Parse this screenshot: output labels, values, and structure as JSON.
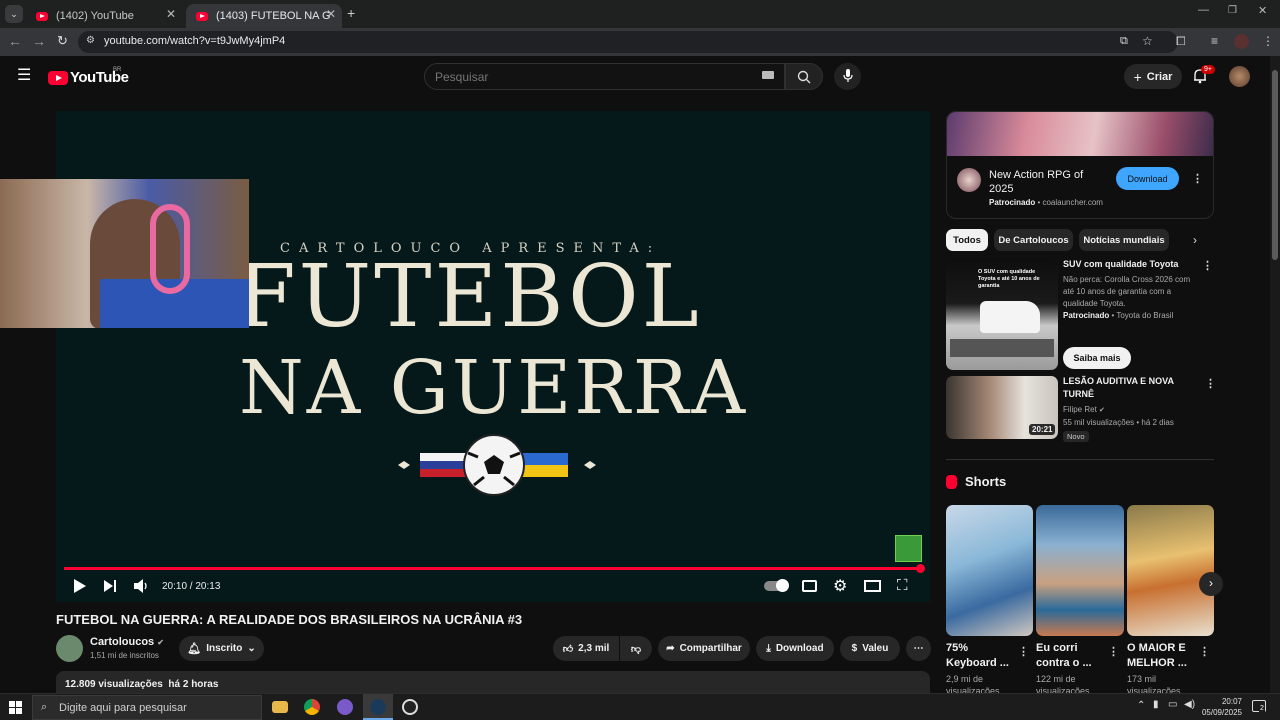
{
  "browser": {
    "tabs": [
      {
        "title": "(1402) YouTube",
        "active": false
      },
      {
        "title": "(1403) FUTEBOL NA GUERRA: A",
        "active": true
      }
    ],
    "url": "youtube.com/watch?v=t9JwMy4jmP4"
  },
  "header": {
    "logo": "YouTube",
    "region": "BR",
    "search_placeholder": "Pesquisar",
    "create_label": "Criar",
    "notif_badge": "9+"
  },
  "player": {
    "overlay_small": "CARTOLOUCO APRESENTA:",
    "overlay_line1": "FUTEBOL",
    "overlay_line2": "NA GUERRA",
    "time": "20:10 / 20:13",
    "progress": 0.998
  },
  "video": {
    "title": "FUTEBOL NA GUERRA: A REALIDADE DOS BRASILEIROS NA UCRÂNIA #3",
    "channel": "Cartoloucos",
    "subs": "1,51 mi de inscritos",
    "subscribed_label": "Inscrito",
    "likes": "2,3 mil",
    "share": "Compartilhar",
    "download": "Download",
    "thanks": "Valeu",
    "views_line": "12.809 visualizações  há 2 horas"
  },
  "sidebar": {
    "ad": {
      "title": "New Action RPG of 2025",
      "sponsored": "Patrocinado",
      "domain": "coalauncher.com",
      "button": "Download"
    },
    "chips": [
      "Todos",
      "De Cartoloucos",
      "Notícias mundiais"
    ],
    "promo": {
      "title": "SUV com qualidade Toyota",
      "desc": "Não perca: Corolla Cross 2026 com até 10 anos de garantia com a qualidade Toyota.",
      "sponsored": "Patrocinado",
      "advertiser": "Toyota do Brasil",
      "cta": "Saiba mais",
      "thumb_text": "O SUV com qualidade Toyota e até 10 anos de garantia"
    },
    "video": {
      "title": "LESÃO AUDITIVA E NOVA TURNÊ",
      "channel": "Filipe Ret",
      "meta": "55 mil visualizações • há 2 dias",
      "badge": "Novo",
      "duration": "20:21"
    },
    "shorts_label": "Shorts",
    "shorts": [
      {
        "title": "75% Keyboard ...",
        "views": "2,9 mi de visualizações"
      },
      {
        "title": "Eu corri contra o ...",
        "views": "122 mi de visualizações"
      },
      {
        "title": "O MAIOR E MELHOR ...",
        "views": "173 mil visualizações"
      }
    ]
  },
  "taskbar": {
    "search_placeholder": "Digite aqui para pesquisar",
    "time": "20:07",
    "date": "05/09/2025",
    "notif_count": "2"
  }
}
